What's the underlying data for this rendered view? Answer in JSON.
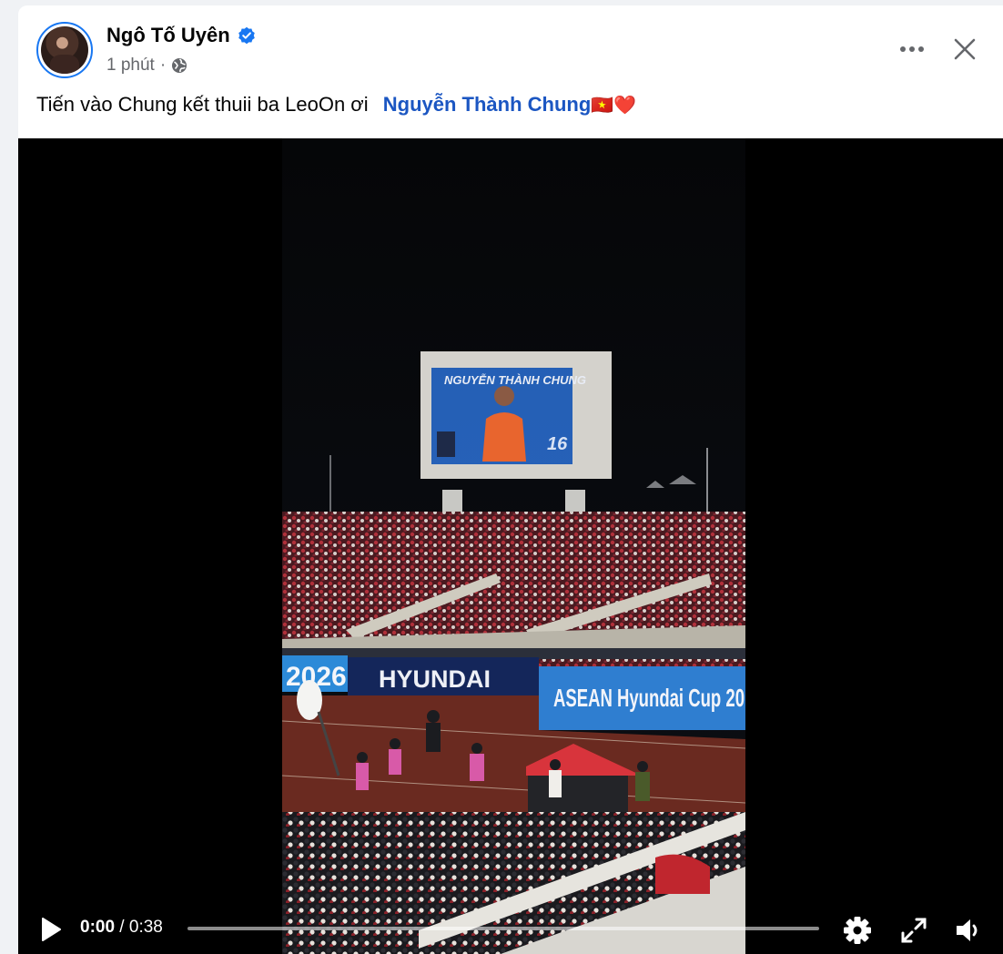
{
  "post": {
    "author_name": "Ngô Tố Uyên",
    "timestamp": "1 phút",
    "separator": "·",
    "text": "Tiến vào Chung kết thuii ba LeoOn ơi",
    "mention": "Nguyễn Thành Chung",
    "emojis": "🇻🇳❤️"
  },
  "video": {
    "current_time": "0:00",
    "time_separator": " / ",
    "duration": "0:38",
    "progress": 0
  },
  "scene": {
    "scoreboard_text": "NGUYỄN THÀNH CHUNG",
    "jersey_number": "16",
    "banner_year": "2026",
    "banner_sponsor": "HYUNDAI",
    "banner_cup": "ASEAN Hyundai Cup 20"
  },
  "icons": {
    "verified": "verified-badge-icon",
    "privacy": "globe-icon",
    "more": "more-options-icon",
    "close": "close-icon",
    "play": "play-icon",
    "settings": "gear-icon",
    "fullscreen": "fullscreen-icon",
    "volume": "volume-icon"
  },
  "colors": {
    "brand_blue": "#1877f2",
    "mention_blue": "#1b56c2"
  }
}
